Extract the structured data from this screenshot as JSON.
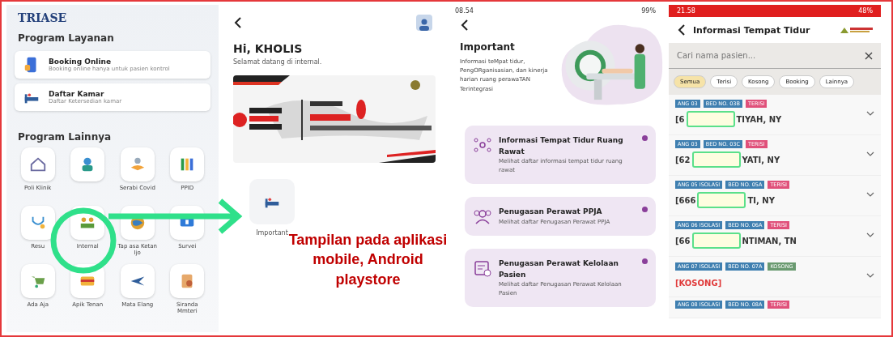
{
  "home": {
    "logo": "TRIASE",
    "section_services": "Program Layanan",
    "services": [
      {
        "title": "Booking Online",
        "subtitle": "Booking online hanya untuk pasien kontrol"
      },
      {
        "title": "Daftar Kamar",
        "subtitle": "Daftar Ketersedian kamar"
      }
    ],
    "section_other": "Program Lainnya",
    "apps": [
      {
        "kind": "labeled",
        "label": "Poli Klinik"
      },
      {
        "kind": "unlabeled"
      },
      {
        "kind": "labeled",
        "label": "Serabi Covid"
      },
      {
        "kind": "labeled",
        "label": "PPID"
      },
      {
        "kind": "labeled",
        "label": "Resu"
      },
      {
        "kind": "labeled",
        "label": "Internal"
      },
      {
        "kind": "labeled",
        "label": "Tap asa Ketan Ijo"
      },
      {
        "kind": "labeled",
        "label": "Survei"
      },
      {
        "kind": "labeled",
        "label": "Ada Aja"
      },
      {
        "kind": "labeled",
        "label": "Apik Tenan"
      },
      {
        "kind": "labeled",
        "label": "Mata Elang"
      },
      {
        "kind": "labeled",
        "label": "Siranda Mmteri"
      }
    ]
  },
  "internal": {
    "greeting": "Hi, KHOLIS",
    "welcome": "Selamat datang di internal.",
    "menu": [
      {
        "label": "Important"
      }
    ]
  },
  "important": {
    "status_bar": {
      "time": "08.54",
      "battery": "99%"
    },
    "title": "Important",
    "description": "Informasi teMpat tidur, PengORganisasian, dan kinerja harian ruang perawaTAN Terintegrasi",
    "cards": [
      {
        "title": "Informasi Tempat Tidur Ruang Rawat",
        "subtitle": "Melihat daftar informasi tempat tidur ruang rawat"
      },
      {
        "title": "Penugasan Perawat PPJA",
        "subtitle": "Melihat daftar Penugasan Perawat PPJA"
      },
      {
        "title": "Penugasan Perawat Kelolaan Pasien",
        "subtitle": "Melihat daftar Penugasan Perawat Kelolaan Pasien"
      }
    ]
  },
  "bed_info": {
    "status_bar": {
      "time": "21.58",
      "battery": "48%"
    },
    "title": "Informasi Tempat Tidur",
    "search": {
      "placeholder": "Cari nama pasien..."
    },
    "filters": [
      {
        "label": "Semua",
        "selected": true
      },
      {
        "label": "Terisi",
        "selected": false
      },
      {
        "label": "Kosong",
        "selected": false
      },
      {
        "label": "Booking",
        "selected": false
      },
      {
        "label": "Lainnya",
        "selected": false
      }
    ],
    "rows": [
      {
        "kind": "patient",
        "tags": [
          {
            "label": "ANG 03",
            "color": "#3f7fb0"
          },
          {
            "label": "BED NO. 03B",
            "color": "#3f7fb0"
          },
          {
            "label": "TERISI",
            "color": "#e0507a"
          }
        ],
        "name_start": "[6",
        "name_end": "TIYAH, NY"
      },
      {
        "kind": "patient",
        "tags": [
          {
            "label": "ANG 03",
            "color": "#3f7fb0"
          },
          {
            "label": "BED NO. 03C",
            "color": "#3f7fb0"
          },
          {
            "label": "TERISI",
            "color": "#e0507a"
          }
        ],
        "name_start": "[62",
        "name_end": "YATI, NY"
      },
      {
        "kind": "patient",
        "tags": [
          {
            "label": "ANG 05 ISOLASI",
            "color": "#3f7fb0"
          },
          {
            "label": "BED NO. 05A",
            "color": "#3f7fb0"
          },
          {
            "label": "TERISI",
            "color": "#e0507a"
          }
        ],
        "name_start": "[666",
        "name_end": "TI, NY"
      },
      {
        "kind": "patient",
        "tags": [
          {
            "label": "ANG 06 ISOLASI",
            "color": "#3f7fb0"
          },
          {
            "label": "BED NO. 06A",
            "color": "#3f7fb0"
          },
          {
            "label": "TERISI",
            "color": "#e0507a"
          }
        ],
        "name_start": "[66",
        "name_end": "NTIMAN, TN"
      },
      {
        "kind": "empty",
        "tags": [
          {
            "label": "ANG 07 ISOLASI",
            "color": "#3f7fb0"
          },
          {
            "label": "BED NO. 07A",
            "color": "#3f7fb0"
          },
          {
            "label": "KOSONG",
            "color": "#6a9a70"
          }
        ],
        "name_start": "[KOSONG]"
      },
      {
        "kind": "partial",
        "tags": [
          {
            "label": "ANG 08 ISOLASI",
            "color": "#3f7fb0"
          },
          {
            "label": "BED NO. 08A",
            "color": "#3f7fb0"
          },
          {
            "label": "TERISI",
            "color": "#e0507a"
          }
        ]
      }
    ]
  },
  "caption": "Tampilan pada **aplikasi** mobile, Android playstore"
}
